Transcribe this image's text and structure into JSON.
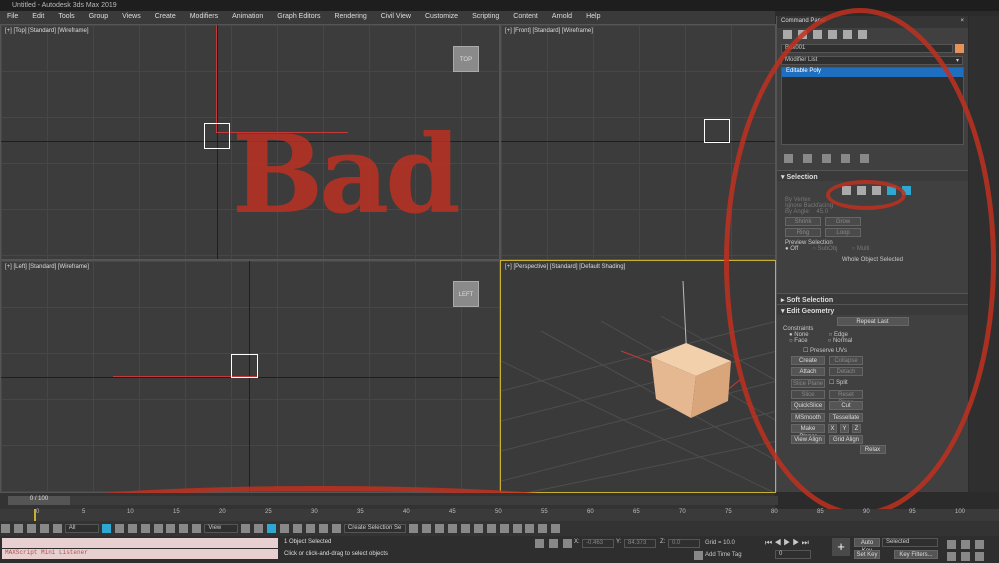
{
  "app": {
    "title": "Untitled - Autodesk 3ds Max 2019"
  },
  "menu": [
    "File",
    "Edit",
    "Tools",
    "Group",
    "Views",
    "Create",
    "Modifiers",
    "Animation",
    "Graph Editors",
    "Rendering",
    "Civil View",
    "Customize",
    "Scripting",
    "Content",
    "Arnold",
    "Help"
  ],
  "viewports": {
    "top": {
      "label": "[+] [Top] [Standard] [Wireframe]",
      "cube": "TOP"
    },
    "front": {
      "label": "[+] [Front] [Standard] [Wireframe]"
    },
    "left": {
      "label": "[+] [Left] [Standard] [Wireframe]",
      "cube": "LEFT"
    },
    "perspective": {
      "label": "[+] [Perspective] [Standard] [Default Shading]"
    }
  },
  "annotation": {
    "text": "Bad"
  },
  "command_panel": {
    "title": "Command Panel",
    "close": "×",
    "object_name": "Box001",
    "modifier_list": "Modifier List",
    "stack_item": "Editable Poly",
    "selection": {
      "title": "Selection",
      "by_vertex": "By Vertex",
      "ignore_backfacing": "Ignore Backfacing",
      "by_angle": "By Angle:",
      "by_angle_value": "45.0",
      "shrink": "Shrink",
      "grow": "Grow",
      "ring": "Ring",
      "loop": "Loop",
      "preview_selection": "Preview Selection",
      "preview_off": "Off",
      "preview_subobj": "SubObj",
      "preview_multi": "Multi",
      "status": "Whole Object Selected"
    },
    "soft_selection": {
      "title": "Soft Selection"
    },
    "edit_geometry": {
      "title": "Edit Geometry",
      "repeat_last": "Repeat Last",
      "constraints": "Constraints",
      "c_none": "None",
      "c_edge": "Edge",
      "c_face": "Face",
      "c_normal": "Normal",
      "preserve_uvs": "Preserve UVs",
      "create": "Create",
      "collapse": "Collapse",
      "attach": "Attach",
      "detach": "Detach",
      "slice_plane": "Slice Plane",
      "split": "Split",
      "slice": "Slice",
      "reset_plane": "Reset Plane",
      "quickslice": "QuickSlice",
      "cut": "Cut",
      "msmooth": "MSmooth",
      "tessellate": "Tessellate",
      "make_planar": "Make Planar",
      "x": "X",
      "y": "Y",
      "z": "Z",
      "view_align": "View Align",
      "grid_align": "Grid Align",
      "relax": "Relax"
    }
  },
  "timeline": {
    "frame": "0 / 100",
    "ticks": [
      "0",
      "5",
      "10",
      "15",
      "20",
      "25",
      "30",
      "35",
      "40",
      "45",
      "50",
      "55",
      "60",
      "65",
      "70",
      "75",
      "80",
      "85",
      "90",
      "95",
      "100"
    ]
  },
  "toolbar": {
    "filter": "All",
    "view": "View",
    "selection_set": "Create Selection Se"
  },
  "status": {
    "maxscript": "MAXScript Mini Listener",
    "objects": "1 Object Selected",
    "prompt": "Click or click-and-drag to select objects",
    "x_label": "X:",
    "x_val": "-0.463",
    "y_label": "Y:",
    "y_val": "84.373",
    "z_label": "Z:",
    "z_val": "0.0",
    "grid": "Grid = 10.0",
    "add_time_tag": "Add Time Tag",
    "auto_key": "Auto Key",
    "set_key": "Set Key",
    "selected": "Selected",
    "key_filters": "Key Filters...",
    "frame_field": "0"
  },
  "colors": {
    "accent": "#1f6fc0",
    "annotation": "#c03020",
    "cube": "#e5b892"
  }
}
